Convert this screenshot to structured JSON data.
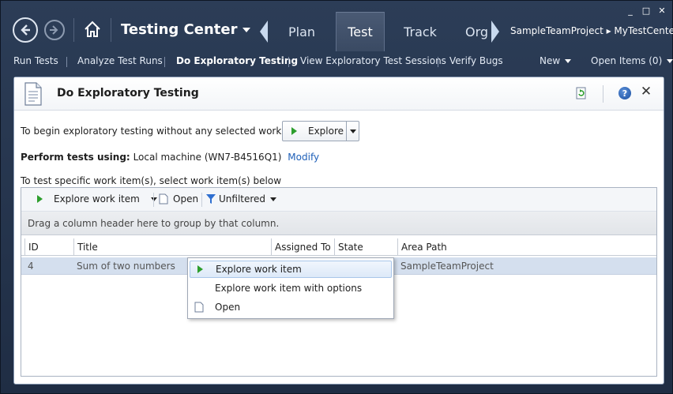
{
  "app": {
    "title": "Testing Center",
    "breadcrumb": "SampleTeamProject ▸ MyTestCenter",
    "tabs": [
      {
        "label": "Plan"
      },
      {
        "label": "Test"
      },
      {
        "label": "Track"
      },
      {
        "label": "Org"
      }
    ],
    "window_controls": {
      "minimize": "_",
      "maximize": "□",
      "close": "✕"
    }
  },
  "menu": {
    "items": [
      {
        "label": "Run Tests"
      },
      {
        "label": "Analyze Test Runs"
      },
      {
        "label": "Do Exploratory Testing"
      },
      {
        "label": "View Exploratory Test Sessions"
      },
      {
        "label": "Verify Bugs"
      }
    ],
    "new_label": "New",
    "open_items_label": "Open Items (0)"
  },
  "panel": {
    "title": "Do Exploratory Testing",
    "begin_text": "To begin exploratory testing without any selected work items:",
    "explore_button": "Explore",
    "perform_label": "Perform tests using:",
    "perform_value": "Local machine (WN7-B4516Q1)",
    "modify_link": "Modify",
    "specific_text": "To test specific work item(s), select work item(s) below"
  },
  "grid": {
    "toolbar": {
      "explore_work_item": "Explore work item",
      "open": "Open",
      "unfiltered": "Unfiltered"
    },
    "group_hint": "Drag a column header here to group by that column.",
    "columns": [
      "ID",
      "Title",
      "Assigned To",
      "State",
      "Area Path"
    ],
    "rows": [
      {
        "id": "4",
        "title": "Sum of two numbers",
        "assigned_to": "",
        "state": "",
        "area_path": "SampleTeamProject"
      }
    ]
  },
  "context_menu": {
    "items": [
      {
        "label": "Explore work item"
      },
      {
        "label": "Explore work item with options"
      },
      {
        "label": "Open"
      }
    ]
  },
  "colors": {
    "chrome_dark": "#2c3d57",
    "accent_blue": "#1e5fb8",
    "play_green": "#2d9e2d",
    "row_selected": "#d4dfee"
  }
}
